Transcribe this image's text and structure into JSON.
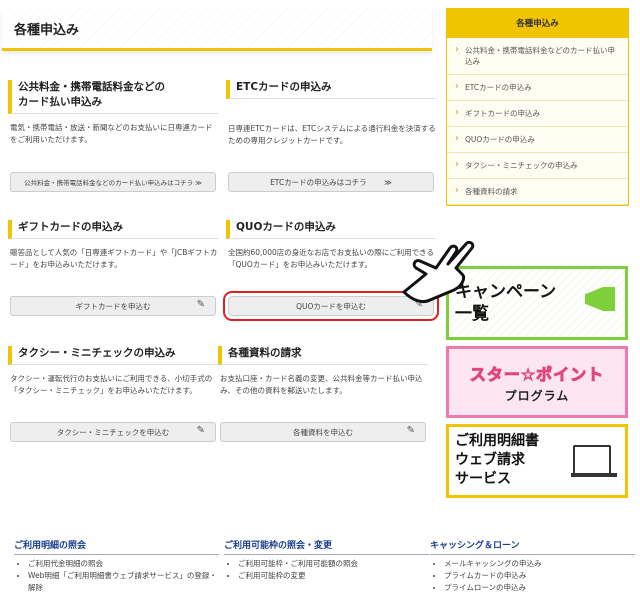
{
  "page_title": "各種申込み",
  "cards": [
    {
      "title_l1": "公共料金・携帯電話料金などの",
      "title_l2": "カード払い申込み",
      "desc": "電気・携帯電話・放送・新聞などのお支払いに日専連カードをご利用いただけます。",
      "button": "公共料金・携帯電話料金などのカード払い申込みはコチラ ≫"
    },
    {
      "title_l1": "ETCカードの申込み",
      "title_l2": "",
      "desc": "日専連ETCカードは、ETCシステムによる通行料金を決済するための専用クレジットカードです。",
      "button": "ETCカードの申込みはコチラ　　 ≫"
    },
    {
      "title_l1": "ギフトカードの申込み",
      "title_l2": "",
      "desc": "贈答品として人気の「日専連ギフトカード」や「JCBギフトカード」をお申込みいただけます。",
      "button": "ギフトカードを申込む"
    },
    {
      "title_l1": "QUOカードの申込み",
      "title_l2": "",
      "desc": "全国約60,000店の身近なお店でお支払いの際にご利用できる「QUOカード」をお申込みいただけます。",
      "button": "QUOカードを申込む"
    },
    {
      "title_l1": "タクシー・ミニチェックの申込み",
      "title_l2": "",
      "desc": "タクシー・運転代行のお支払いにご利用できる、小切手式の「タクシー・ミニチェック」をお申込みいただけます。",
      "button": "タクシー・ミニチェックを申込む"
    },
    {
      "title_l1": "各種資料の請求",
      "title_l2": "",
      "desc": "お支払口座・カード名義の変更、公共料金等カード払い申込み、その他の資料を郵送いたします。",
      "button": "各種資料を申込む"
    }
  ],
  "sidebar": {
    "title": "各種申込み",
    "items": [
      {
        "label": "公共料金・携帯電話料金などのカード払い申込み"
      },
      {
        "label": "ETCカードの申込み"
      },
      {
        "label": "ギフトカードの申込み"
      },
      {
        "label": "QUOカードの申込み"
      },
      {
        "label": "タクシー・ミニチェックの申込み"
      },
      {
        "label": "各種資料の請求"
      }
    ]
  },
  "banners": {
    "campaign_l1": "キャンペーン",
    "campaign_l2": "一覧",
    "star_l1": "スター☆ポイント",
    "star_l2": "プログラム",
    "web_l1": "ご利用明細書",
    "web_l2": "ウェブ請求",
    "web_l3": "サービス"
  },
  "footer": [
    {
      "heading": "ご利用明細の照会",
      "items": [
        "ご利用代金明細の照会",
        "Web明細「ご利用明細書ウェブ請求サービス」の登録・解除"
      ]
    },
    {
      "heading": "ご利用可能枠の照会・変更",
      "items": [
        "ご利用可能枠・ご利用可能額の照会",
        "ご利用可能枠の変更"
      ]
    },
    {
      "heading": "キャッシング＆ローン",
      "items": [
        "メールキャッシングの申込み",
        "プライムカードの申込み",
        "プライムローンの申込み"
      ]
    }
  ],
  "icons": {
    "edit": "edit-icon",
    "arrow": "double-chevron-icon",
    "pointer": "hand-pointer-icon"
  },
  "colors": {
    "accent": "#f0c400",
    "highlight": "#e02020",
    "link": "#1a3e8c"
  }
}
